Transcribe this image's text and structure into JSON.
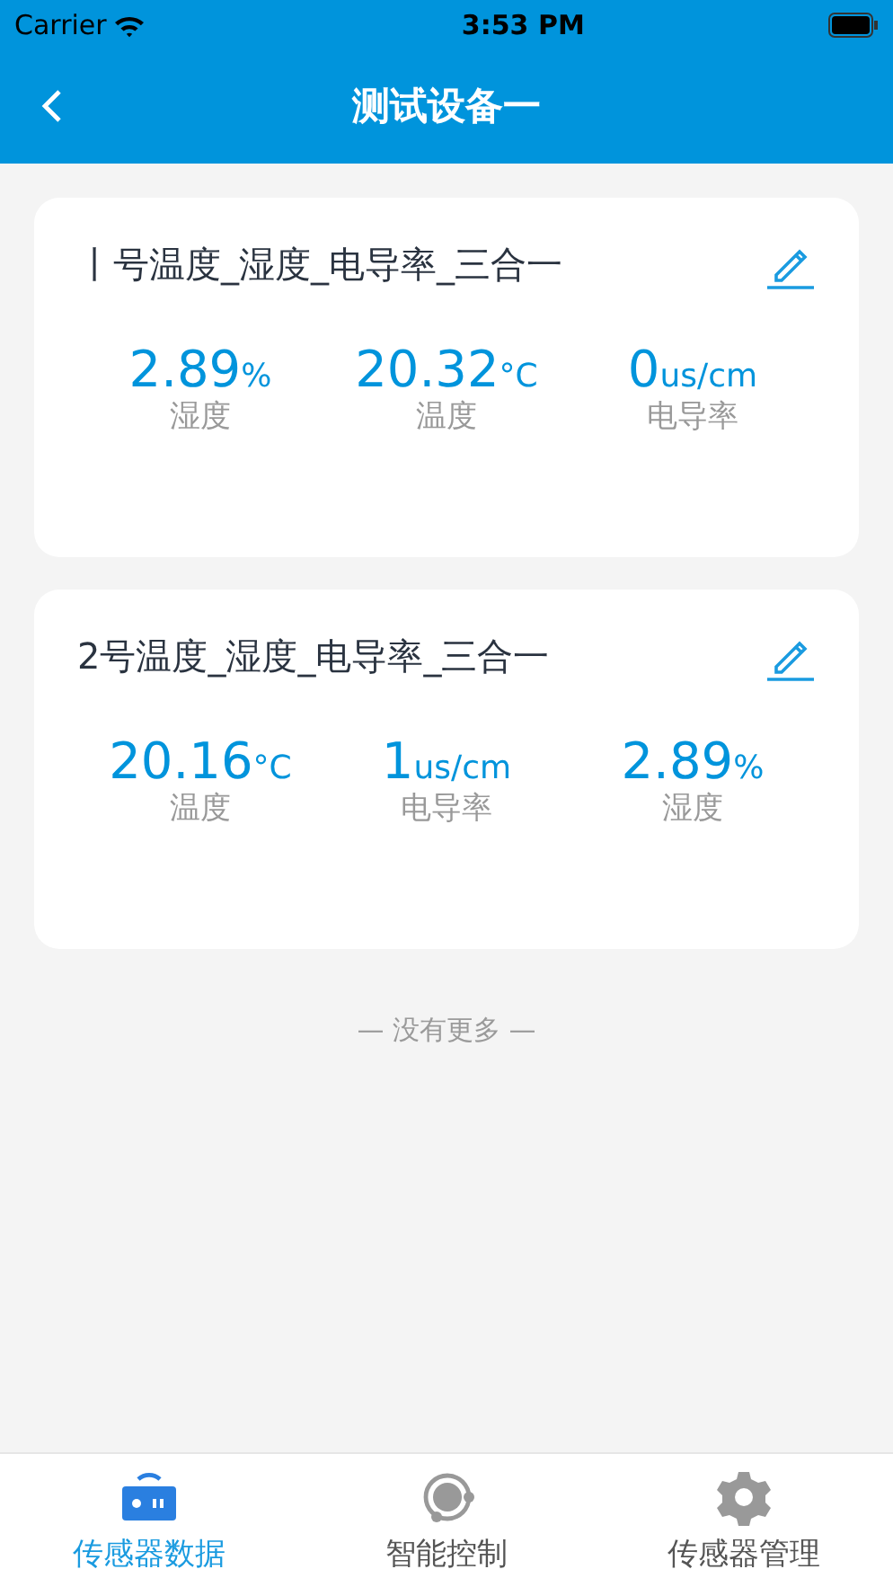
{
  "status_bar": {
    "carrier": "Carrier",
    "time": "3:53 PM"
  },
  "nav": {
    "title": "测试设备一"
  },
  "devices": [
    {
      "name": "丨号温度_湿度_电导率_三合一",
      "readings": [
        {
          "value": "2.89",
          "unit": "%",
          "label": "湿度"
        },
        {
          "value": "20.32",
          "unit": "°C",
          "label": "温度"
        },
        {
          "value": "0",
          "unit": "us/cm",
          "label": "电导率"
        }
      ]
    },
    {
      "name": "2号温度_湿度_电导率_三合一",
      "readings": [
        {
          "value": "20.16",
          "unit": "°C",
          "label": "温度"
        },
        {
          "value": "1",
          "unit": "us/cm",
          "label": "电导率"
        },
        {
          "value": "2.89",
          "unit": "%",
          "label": "湿度"
        }
      ]
    }
  ],
  "footer_note": "— 没有更多 —",
  "tabs": [
    {
      "label": "传感器数据",
      "kind": "data",
      "selected": true
    },
    {
      "label": "智能控制",
      "kind": "control",
      "selected": false
    },
    {
      "label": "传感器管理",
      "kind": "manage",
      "selected": false
    }
  ]
}
